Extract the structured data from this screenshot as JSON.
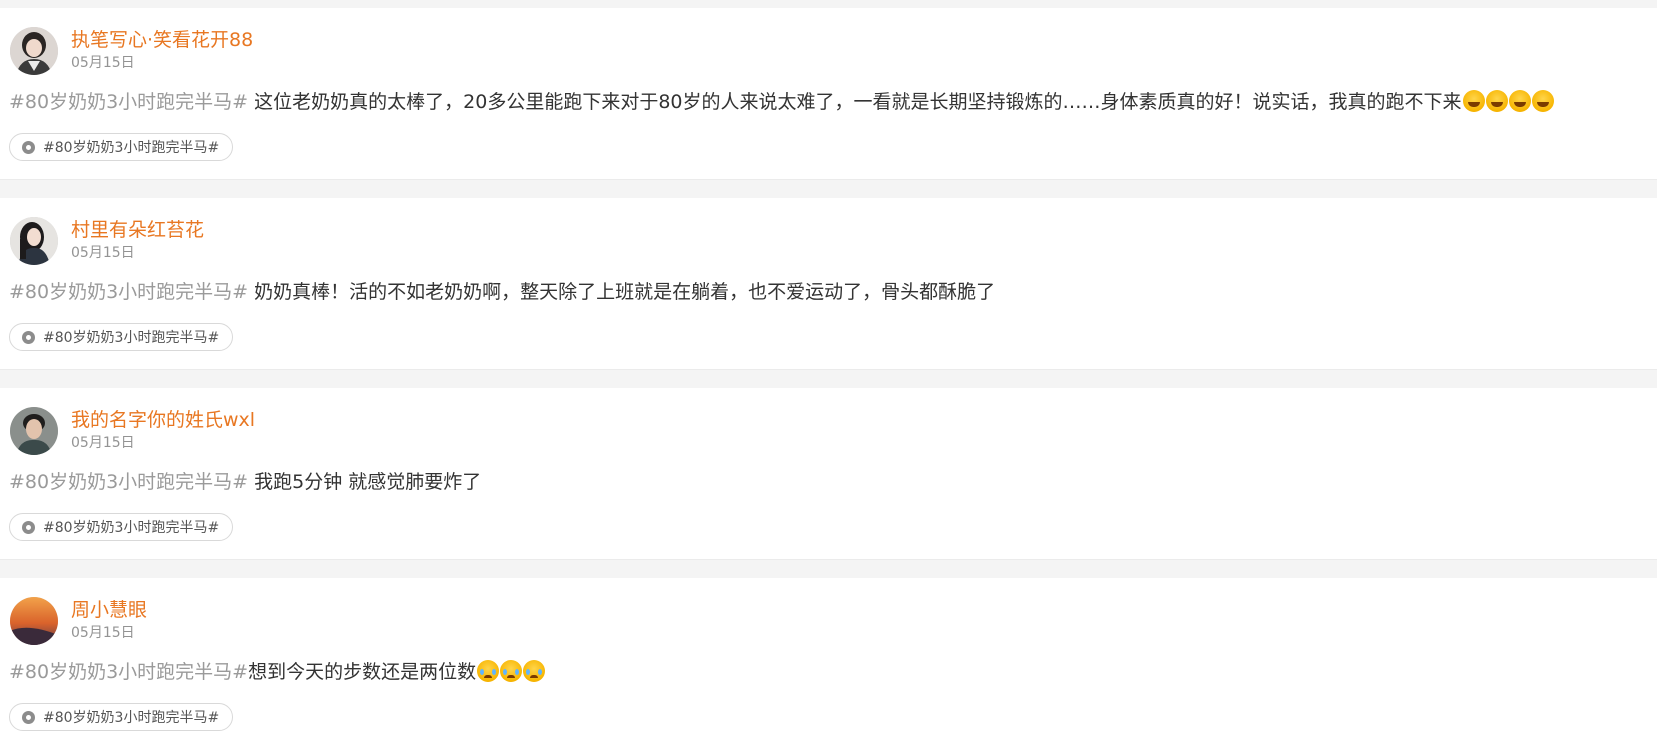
{
  "posts": [
    {
      "username": "执笔写心·笑看花开88",
      "date": "05月15日",
      "hashtag": "#80岁奶奶3小时跑完半马#",
      "text": " 这位老奶奶真的太棒了，20多公里能跑下来对于80岁的人来说太难了，一看就是长期坚持锻炼的……身体素质真的好！说实话，我真的跑不下来",
      "emoji_count": 4,
      "emoji_name": "laugh-cry-emoji",
      "topic": "#80岁奶奶3小时跑完半马#"
    },
    {
      "username": "村里有朵红苔花",
      "date": "05月15日",
      "hashtag": "#80岁奶奶3小时跑完半马#",
      "text": " 奶奶真棒！活的不如老奶奶啊，整天除了上班就是在躺着，也不爱运动了，骨头都酥脆了",
      "emoji_count": 0,
      "emoji_name": "",
      "topic": "#80岁奶奶3小时跑完半马#"
    },
    {
      "username": "我的名字你的姓氏wxl",
      "date": "05月15日",
      "hashtag": "#80岁奶奶3小时跑完半马#",
      "text": " 我跑5分钟 就感觉肺要炸了",
      "emoji_count": 0,
      "emoji_name": "",
      "topic": "#80岁奶奶3小时跑完半马#"
    },
    {
      "username": "周小慧眼",
      "date": "05月15日",
      "hashtag": "#80岁奶奶3小时跑完半马#",
      "text": "想到今天的步数还是两位数",
      "emoji_count": 3,
      "emoji_name": "crying-emoji",
      "topic": "#80岁奶奶3小时跑完半马#"
    }
  ],
  "colors": {
    "username": "#e87722",
    "hashtag": "#9a9a9a",
    "body_text": "#333333",
    "date": "#939393"
  },
  "icons": {
    "topic_chip": "topic-icon"
  }
}
